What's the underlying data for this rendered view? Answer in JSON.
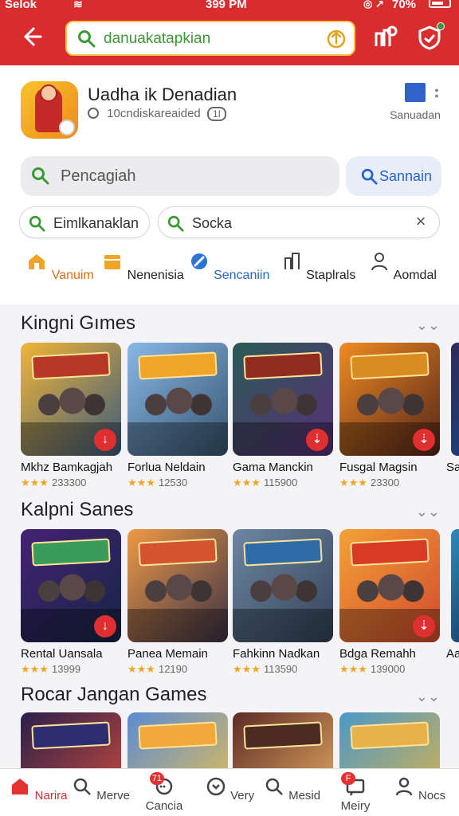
{
  "status": {
    "carrier": "Selok",
    "time": "399 PM",
    "battery": "70%"
  },
  "header": {
    "search_text": "danuakatapkian",
    "back_icon": "back-arrow-icon",
    "icon_1": "user-settings-icon",
    "icon_2": "shield-icon"
  },
  "app": {
    "name": "Uadha ik Denadian",
    "meta": "10cndiskareaided",
    "meta_badge": "1I",
    "side_label": "Sanuadan"
  },
  "search": {
    "main": "Pencagiah",
    "button": "Sannain",
    "chip_1": "Eimlkanaklan",
    "chip_2": "Socka"
  },
  "tabs": [
    {
      "label": "Vanuim",
      "icon": "home-icon",
      "color": "#f0a428"
    },
    {
      "label": "Nenenisia",
      "icon": "box-icon",
      "color": "#f0a428"
    },
    {
      "label": "Sencaniin",
      "icon": "rocket-icon",
      "color": "#2367c7"
    },
    {
      "label": "Staplrals",
      "icon": "building-icon",
      "color": "#222"
    },
    {
      "label": "Aomdal",
      "icon": "profile-icon",
      "color": "#222"
    }
  ],
  "sections": [
    {
      "title": "Kingni Gımes",
      "games": [
        {
          "name": "Mkhz Bamkagjah",
          "rating": "233300",
          "palette": [
            "#f0b534",
            "#3d5b7e"
          ]
        },
        {
          "name": "Forlua Neldain",
          "rating": "12530",
          "palette": [
            "#88b8e6",
            "#37546f"
          ]
        },
        {
          "name": "Gama Manckin",
          "rating": "115900",
          "palette": [
            "#2b5a56",
            "#582f77"
          ]
        },
        {
          "name": "Fusgal Magsin",
          "rating": "23300",
          "palette": [
            "#ef8a22",
            "#542519"
          ]
        }
      ],
      "overflow_label": "Sa"
    },
    {
      "title": "Kalpni Sanes",
      "games": [
        {
          "name": "Rental Uansala",
          "rating": "13999",
          "palette": [
            "#452274",
            "#152644"
          ]
        },
        {
          "name": "Panea Memain",
          "rating": "12190",
          "palette": [
            "#ee9a44",
            "#3d3247"
          ]
        },
        {
          "name": "Fahkinn Nadkan",
          "rating": "113590",
          "palette": [
            "#6d86a1",
            "#334359"
          ]
        },
        {
          "name": "Bdga Remahh",
          "rating": "139000",
          "palette": [
            "#f3a138",
            "#d24a2c"
          ]
        }
      ],
      "overflow_label": "Aa"
    },
    {
      "title": "Rocar Jangan Games",
      "games": [
        {
          "name": "",
          "rating": "",
          "palette": [
            "#2a1f4b",
            "#d74f3c"
          ]
        },
        {
          "name": "",
          "rating": "",
          "palette": [
            "#5b8bd3",
            "#f1c34a"
          ]
        },
        {
          "name": "",
          "rating": "",
          "palette": [
            "#5d2b26",
            "#f2b768"
          ]
        },
        {
          "name": "",
          "rating": "",
          "palette": [
            "#4b98c7",
            "#e5b542"
          ]
        }
      ],
      "overflow_label": ""
    }
  ],
  "bottom_nav": [
    {
      "label": "Narira",
      "icon": "home-icon",
      "active": true
    },
    {
      "label": "Merve",
      "icon": "search-icon"
    },
    {
      "label": "Cancia",
      "icon": "chat-icon",
      "badge": "71"
    },
    {
      "label": "Very",
      "icon": "compass-icon"
    },
    {
      "label": "Mesid",
      "icon": "search-icon"
    },
    {
      "label": "Meiry",
      "icon": "message-icon",
      "badge": "F"
    },
    {
      "label": "Nocs",
      "icon": "profile-icon"
    }
  ],
  "colors": {
    "brand_red": "#d82c2f",
    "accent_blue": "#2367c7",
    "accent_green": "#3a9a35",
    "rating_star": "#f0a526"
  }
}
